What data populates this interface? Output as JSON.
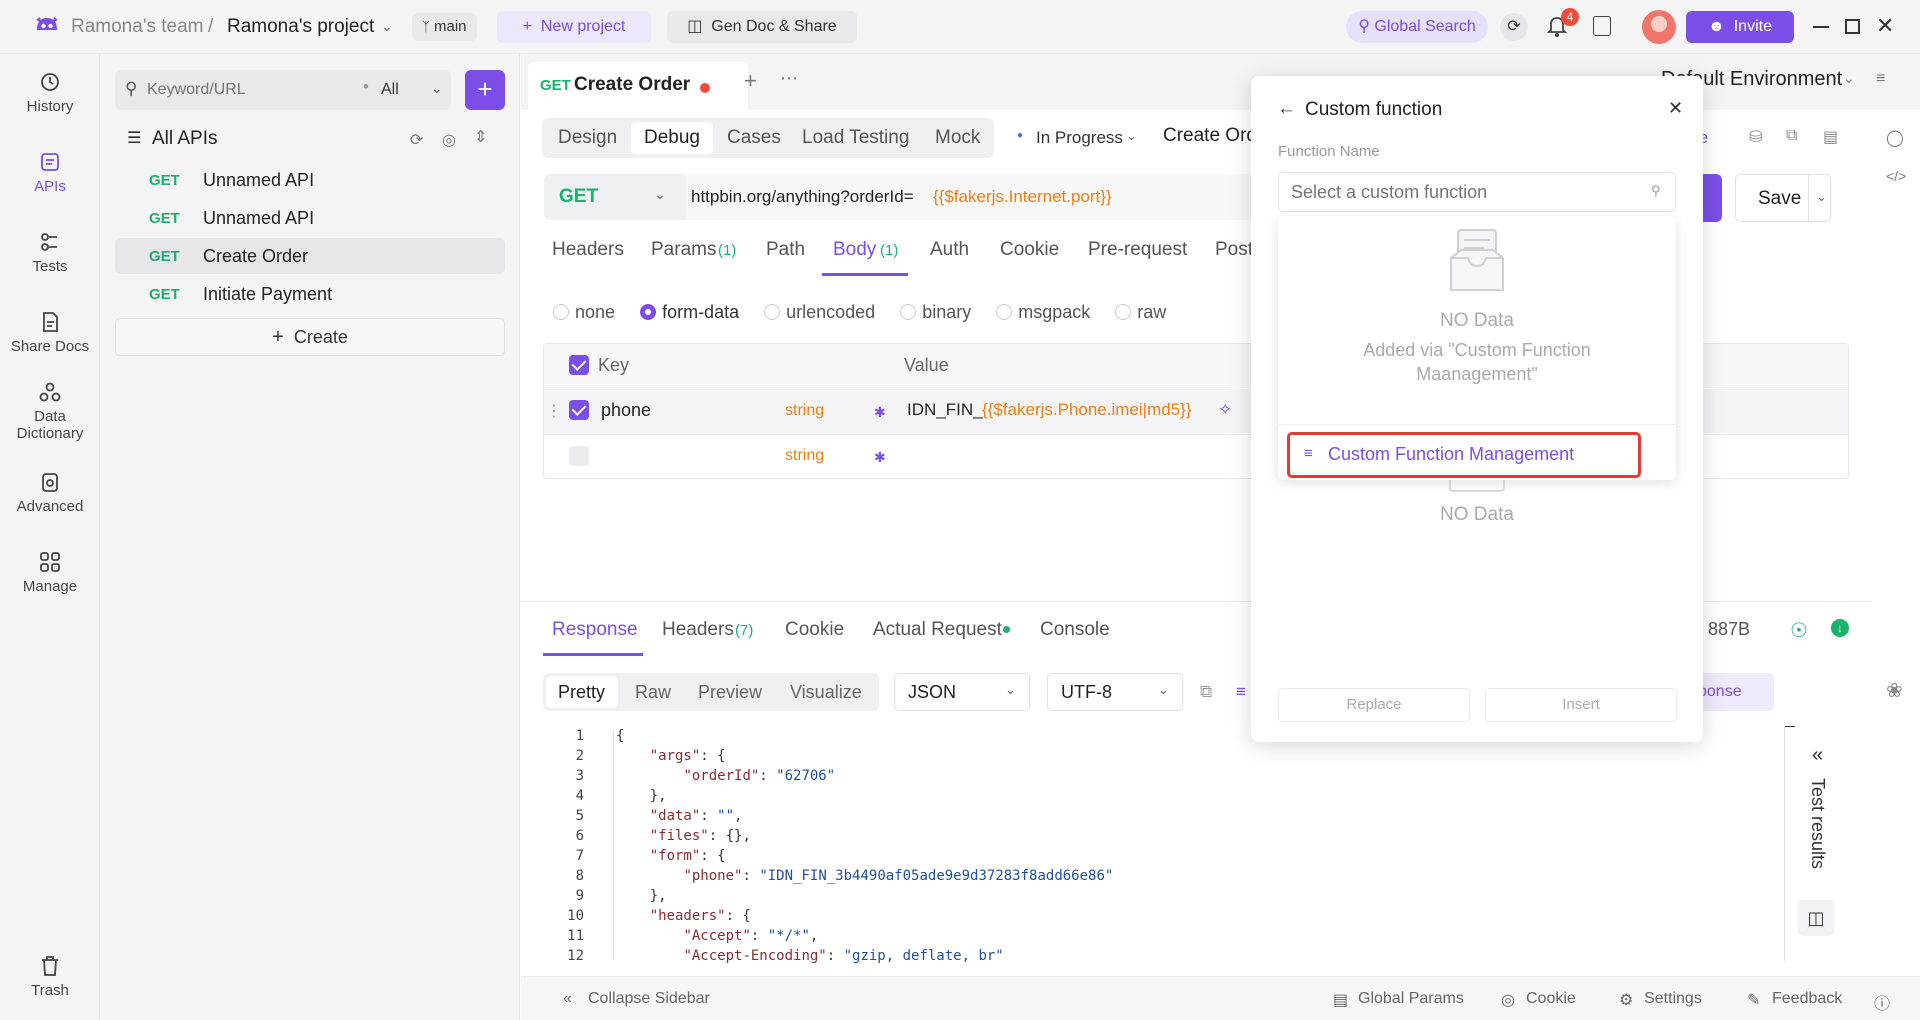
{
  "titlebar": {
    "team": "Ramona's team",
    "separator": "/",
    "project": "Ramona's project",
    "branch": "main",
    "new_project": "New project",
    "gen_doc": "Gen Doc & Share",
    "global_search": "Global Search",
    "notification_count": "4",
    "invite": "Invite"
  },
  "nav": [
    {
      "label": "History",
      "icon": "history-icon"
    },
    {
      "label": "APIs",
      "icon": "apis-icon"
    },
    {
      "label": "Tests",
      "icon": "tests-icon"
    },
    {
      "label": "Share Docs",
      "icon": "share-docs-icon"
    },
    {
      "label": "Data",
      "label2": "Dictionary",
      "icon": "data-dictionary-icon"
    },
    {
      "label": "Advanced",
      "icon": "advanced-icon"
    },
    {
      "label": "Manage",
      "icon": "manage-icon"
    },
    {
      "label": "Trash",
      "icon": "trash-icon"
    }
  ],
  "sidebar": {
    "search_placeholder": "Keyword/URL",
    "filter": "All",
    "all_apis": "All APIs",
    "apis": [
      {
        "method": "GET",
        "name": "Unnamed API"
      },
      {
        "method": "GET",
        "name": "Unnamed API"
      },
      {
        "method": "GET",
        "name": "Create Order"
      },
      {
        "method": "GET",
        "name": "Initiate Payment"
      }
    ],
    "create": "Create"
  },
  "tab": {
    "method": "GET",
    "title": "Create Order"
  },
  "environment": "Default Environment",
  "modes": [
    "Design",
    "Debug",
    "Cases",
    "Load Testing",
    "Mock"
  ],
  "active_mode": "Debug",
  "status": "In Progress",
  "api_name_partial": "Create Ord",
  "share_partial": "re",
  "request": {
    "method": "GET",
    "url_prefix": "httpbin.org/anything?orderId=",
    "url_var": "{{$fakerjs.Internet.port}}",
    "save": "Save"
  },
  "req_tabs": [
    {
      "label": "Headers"
    },
    {
      "label": "Params",
      "count": "(1)"
    },
    {
      "label": "Path"
    },
    {
      "label": "Body",
      "count": "(1)"
    },
    {
      "label": "Auth"
    },
    {
      "label": "Cookie"
    },
    {
      "label": "Pre-request"
    },
    {
      "label": "Post"
    }
  ],
  "body_types": [
    "none",
    "form-data",
    "urlencoded",
    "binary",
    "msgpack",
    "raw"
  ],
  "body_selected": "form-data",
  "params_table": {
    "headers": [
      "Key",
      "Value"
    ],
    "rows": [
      {
        "key": "phone",
        "type": "string",
        "value_prefix": "IDN_FIN_",
        "value_var": "{{$fakerjs.Phone.imei|md5}}"
      },
      {
        "key": "",
        "type": "string",
        "value_prefix": "",
        "value_var": ""
      }
    ]
  },
  "response": {
    "tabs": [
      {
        "label": "Response"
      },
      {
        "label": "Headers",
        "count": "(7)"
      },
      {
        "label": "Cookie"
      },
      {
        "label": "Actual Request"
      },
      {
        "label": "Console"
      }
    ],
    "size": "887B",
    "views": [
      "Pretty",
      "Raw",
      "Preview",
      "Visualize"
    ],
    "format": "JSON",
    "encoding": "UTF-8",
    "save_response_partial": "sponse",
    "test_results": "Test results",
    "lines": [
      {
        "n": "1",
        "t": "{"
      },
      {
        "n": "2",
        "t": "    \"args\": {"
      },
      {
        "n": "3",
        "t": "        \"orderId\": \"62706\""
      },
      {
        "n": "4",
        "t": "    },"
      },
      {
        "n": "5",
        "t": "    \"data\": \"\","
      },
      {
        "n": "6",
        "t": "    \"files\": {},"
      },
      {
        "n": "7",
        "t": "    \"form\": {"
      },
      {
        "n": "8",
        "t": "        \"phone\": \"IDN_FIN_3b4490af05ade9e9d37283f8add66e86\""
      },
      {
        "n": "9",
        "t": "    },"
      },
      {
        "n": "10",
        "t": "    \"headers\": {"
      },
      {
        "n": "11",
        "t": "        \"Accept\": \"*/*\","
      },
      {
        "n": "12",
        "t": "        \"Accept-Encoding\": \"gzip, deflate, br\""
      }
    ]
  },
  "custom_function": {
    "title": "Custom function",
    "field_label": "Function Name",
    "placeholder": "Select a custom function",
    "no_data": "NO Data",
    "hint": "Added via \"Custom Function Maanagement\"",
    "manage_link": "Custom Function Management",
    "no_data_2": "NO Data",
    "replace": "Replace",
    "insert": "Insert"
  },
  "footer": {
    "collapse": "Collapse Sidebar",
    "global_params": "Global Params",
    "cookie": "Cookie",
    "settings": "Settings",
    "feedback": "Feedback"
  },
  "colors": {
    "accent": "#7b4ee8",
    "get_method": "#19b26b",
    "variable": "#ef7d12",
    "highlight_border": "#e53935"
  }
}
